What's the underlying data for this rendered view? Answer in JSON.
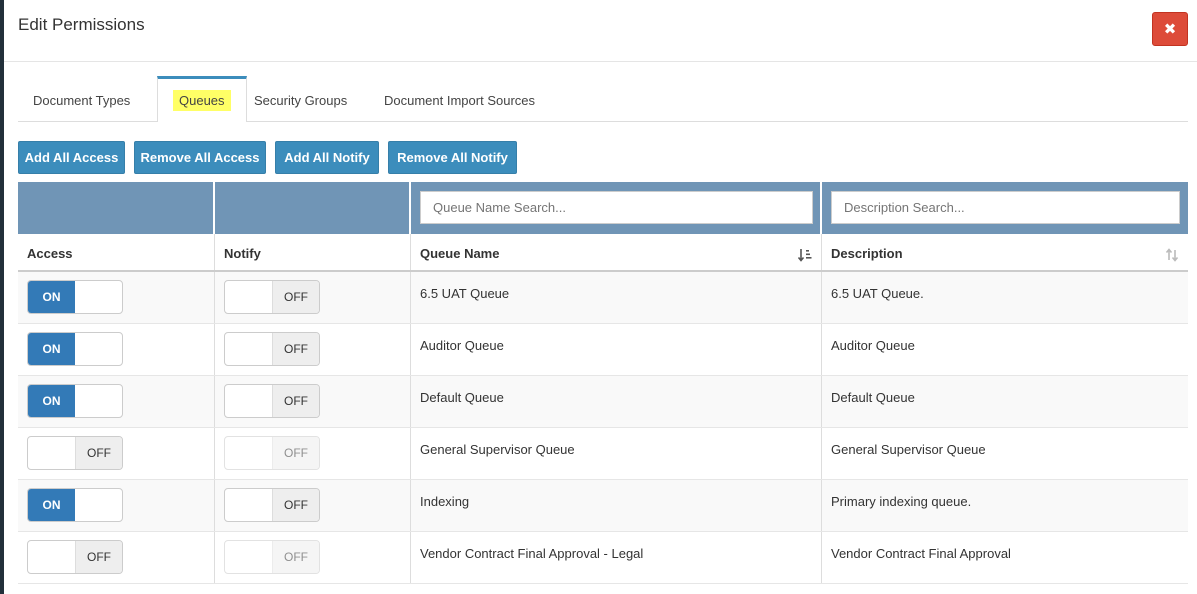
{
  "modal": {
    "title": "Edit Permissions",
    "close_symbol": "✖"
  },
  "tabs": [
    {
      "label": "Document Types",
      "active": false
    },
    {
      "label": "Queues",
      "active": true
    },
    {
      "label": "Security Groups",
      "active": false
    },
    {
      "label": "Document Import Sources",
      "active": false
    }
  ],
  "actions": {
    "add_all_access": "Add All Access",
    "remove_all_access": "Remove All Access",
    "add_all_notify": "Add All Notify",
    "remove_all_notify": "Remove All Notify"
  },
  "filters": {
    "queue_name_placeholder": "Queue Name Search...",
    "description_placeholder": "Description Search..."
  },
  "columns": {
    "access": "Access",
    "notify": "Notify",
    "queue_name": "Queue Name",
    "description": "Description"
  },
  "toggle_labels": {
    "on": "ON",
    "off": "OFF"
  },
  "rows": [
    {
      "access": true,
      "notify": false,
      "notify_enabled": true,
      "queue_name": "6.5 UAT Queue",
      "description": "6.5 UAT Queue."
    },
    {
      "access": true,
      "notify": false,
      "notify_enabled": true,
      "queue_name": "Auditor Queue",
      "description": "Auditor Queue"
    },
    {
      "access": true,
      "notify": false,
      "notify_enabled": true,
      "queue_name": "Default Queue",
      "description": "Default Queue"
    },
    {
      "access": false,
      "notify": false,
      "notify_enabled": false,
      "queue_name": "General Supervisor Queue",
      "description": "General Supervisor Queue"
    },
    {
      "access": true,
      "notify": false,
      "notify_enabled": true,
      "queue_name": "Indexing",
      "description": "Primary indexing queue."
    },
    {
      "access": false,
      "notify": false,
      "notify_enabled": false,
      "queue_name": "Vendor Contract Final Approval - Legal",
      "description": "Vendor Contract Final Approval"
    }
  ],
  "colors": {
    "primary": "#3c8dbc",
    "toggle_on": "#337ab7",
    "close": "#dd4b39",
    "filter_bar": "#7095b6",
    "highlight": "#ffff66"
  }
}
